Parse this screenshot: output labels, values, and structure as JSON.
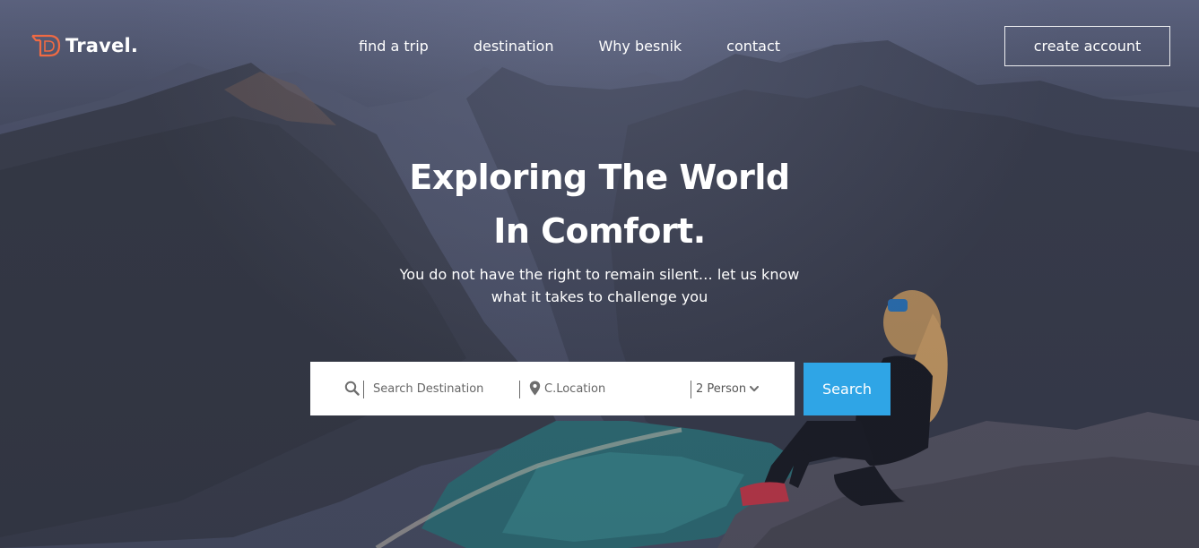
{
  "brand": {
    "name": "Travel.",
    "logo_letter": "D",
    "accent": "#f06a43"
  },
  "nav": {
    "items": [
      {
        "label": "find a trip"
      },
      {
        "label": "destination"
      },
      {
        "label": "Why besnik"
      },
      {
        "label": "contact"
      }
    ],
    "cta_label": "create account"
  },
  "hero": {
    "headline_line1": "Exploring The World",
    "headline_line2": "In Comfort.",
    "sub_line1": "You do not have the right to remain silent… let us know",
    "sub_line2": "what it takes to challenge you"
  },
  "search": {
    "destination_placeholder": "Search Destination",
    "location_placeholder": "C.Location",
    "person_value": "2 Person",
    "button_label": "Search",
    "button_color": "#2fa5e6",
    "icons": [
      "search-icon",
      "location-pin-icon",
      "chevron-down-icon"
    ]
  }
}
